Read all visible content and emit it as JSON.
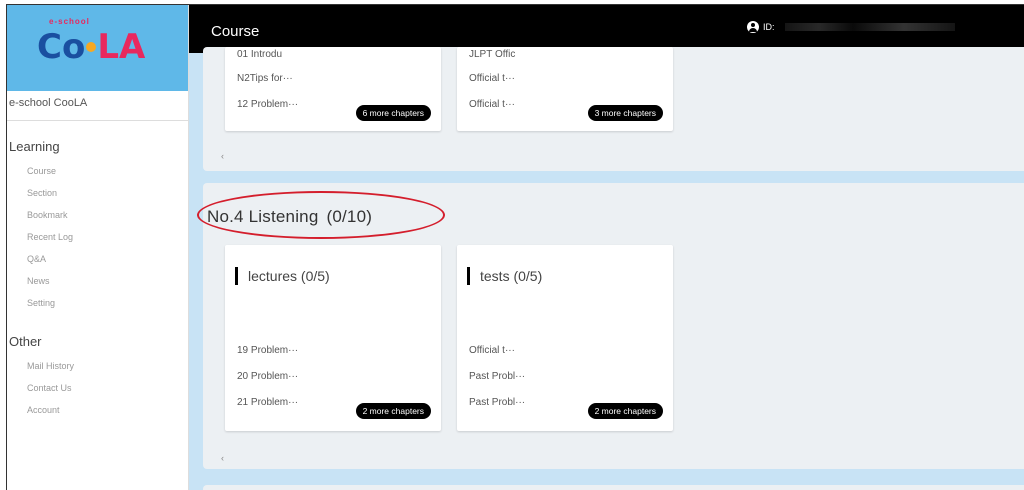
{
  "sidebar": {
    "logo_small": "e-school",
    "logo_text_c": "Co",
    "logo_text_la": "LA",
    "school_name": "e-school CooLA",
    "learning_head": "Learning",
    "learning_items": [
      "Course",
      "Section",
      "Bookmark",
      "Recent Log",
      "Q&A",
      "News",
      "Setting"
    ],
    "other_head": "Other",
    "other_items": [
      "Mail History",
      "Contact Us",
      "Account"
    ]
  },
  "topbar": {
    "title": "Course",
    "user_id_label": "ID:"
  },
  "section1": {
    "cards": [
      {
        "rows": [
          "01 Introdu",
          "N2Tips for···",
          "12 Problem···"
        ],
        "more": "6 more chapters"
      },
      {
        "rows": [
          "JLPT Offic",
          "Official t···",
          "Official t···"
        ],
        "more": "3 more chapters"
      }
    ],
    "arrow": "‹"
  },
  "section2": {
    "title": "No.4 Listening",
    "progress": "(0/10)",
    "cards": [
      {
        "head": "lectures (0/5)",
        "rows": [
          "19 Problem···",
          "20 Problem···",
          "21 Problem···"
        ],
        "more": "2 more chapters"
      },
      {
        "head": "tests (0/5)",
        "rows": [
          "Official t···",
          "Past Probl···",
          "Past Probl···"
        ],
        "more": "2 more chapters"
      }
    ],
    "arrow": "‹"
  },
  "colors": {
    "topbar": "#000000",
    "main_bg": "#c8e3f5",
    "logo_bg": "#5fb8e8",
    "highlight_circle": "#d41e2c"
  }
}
